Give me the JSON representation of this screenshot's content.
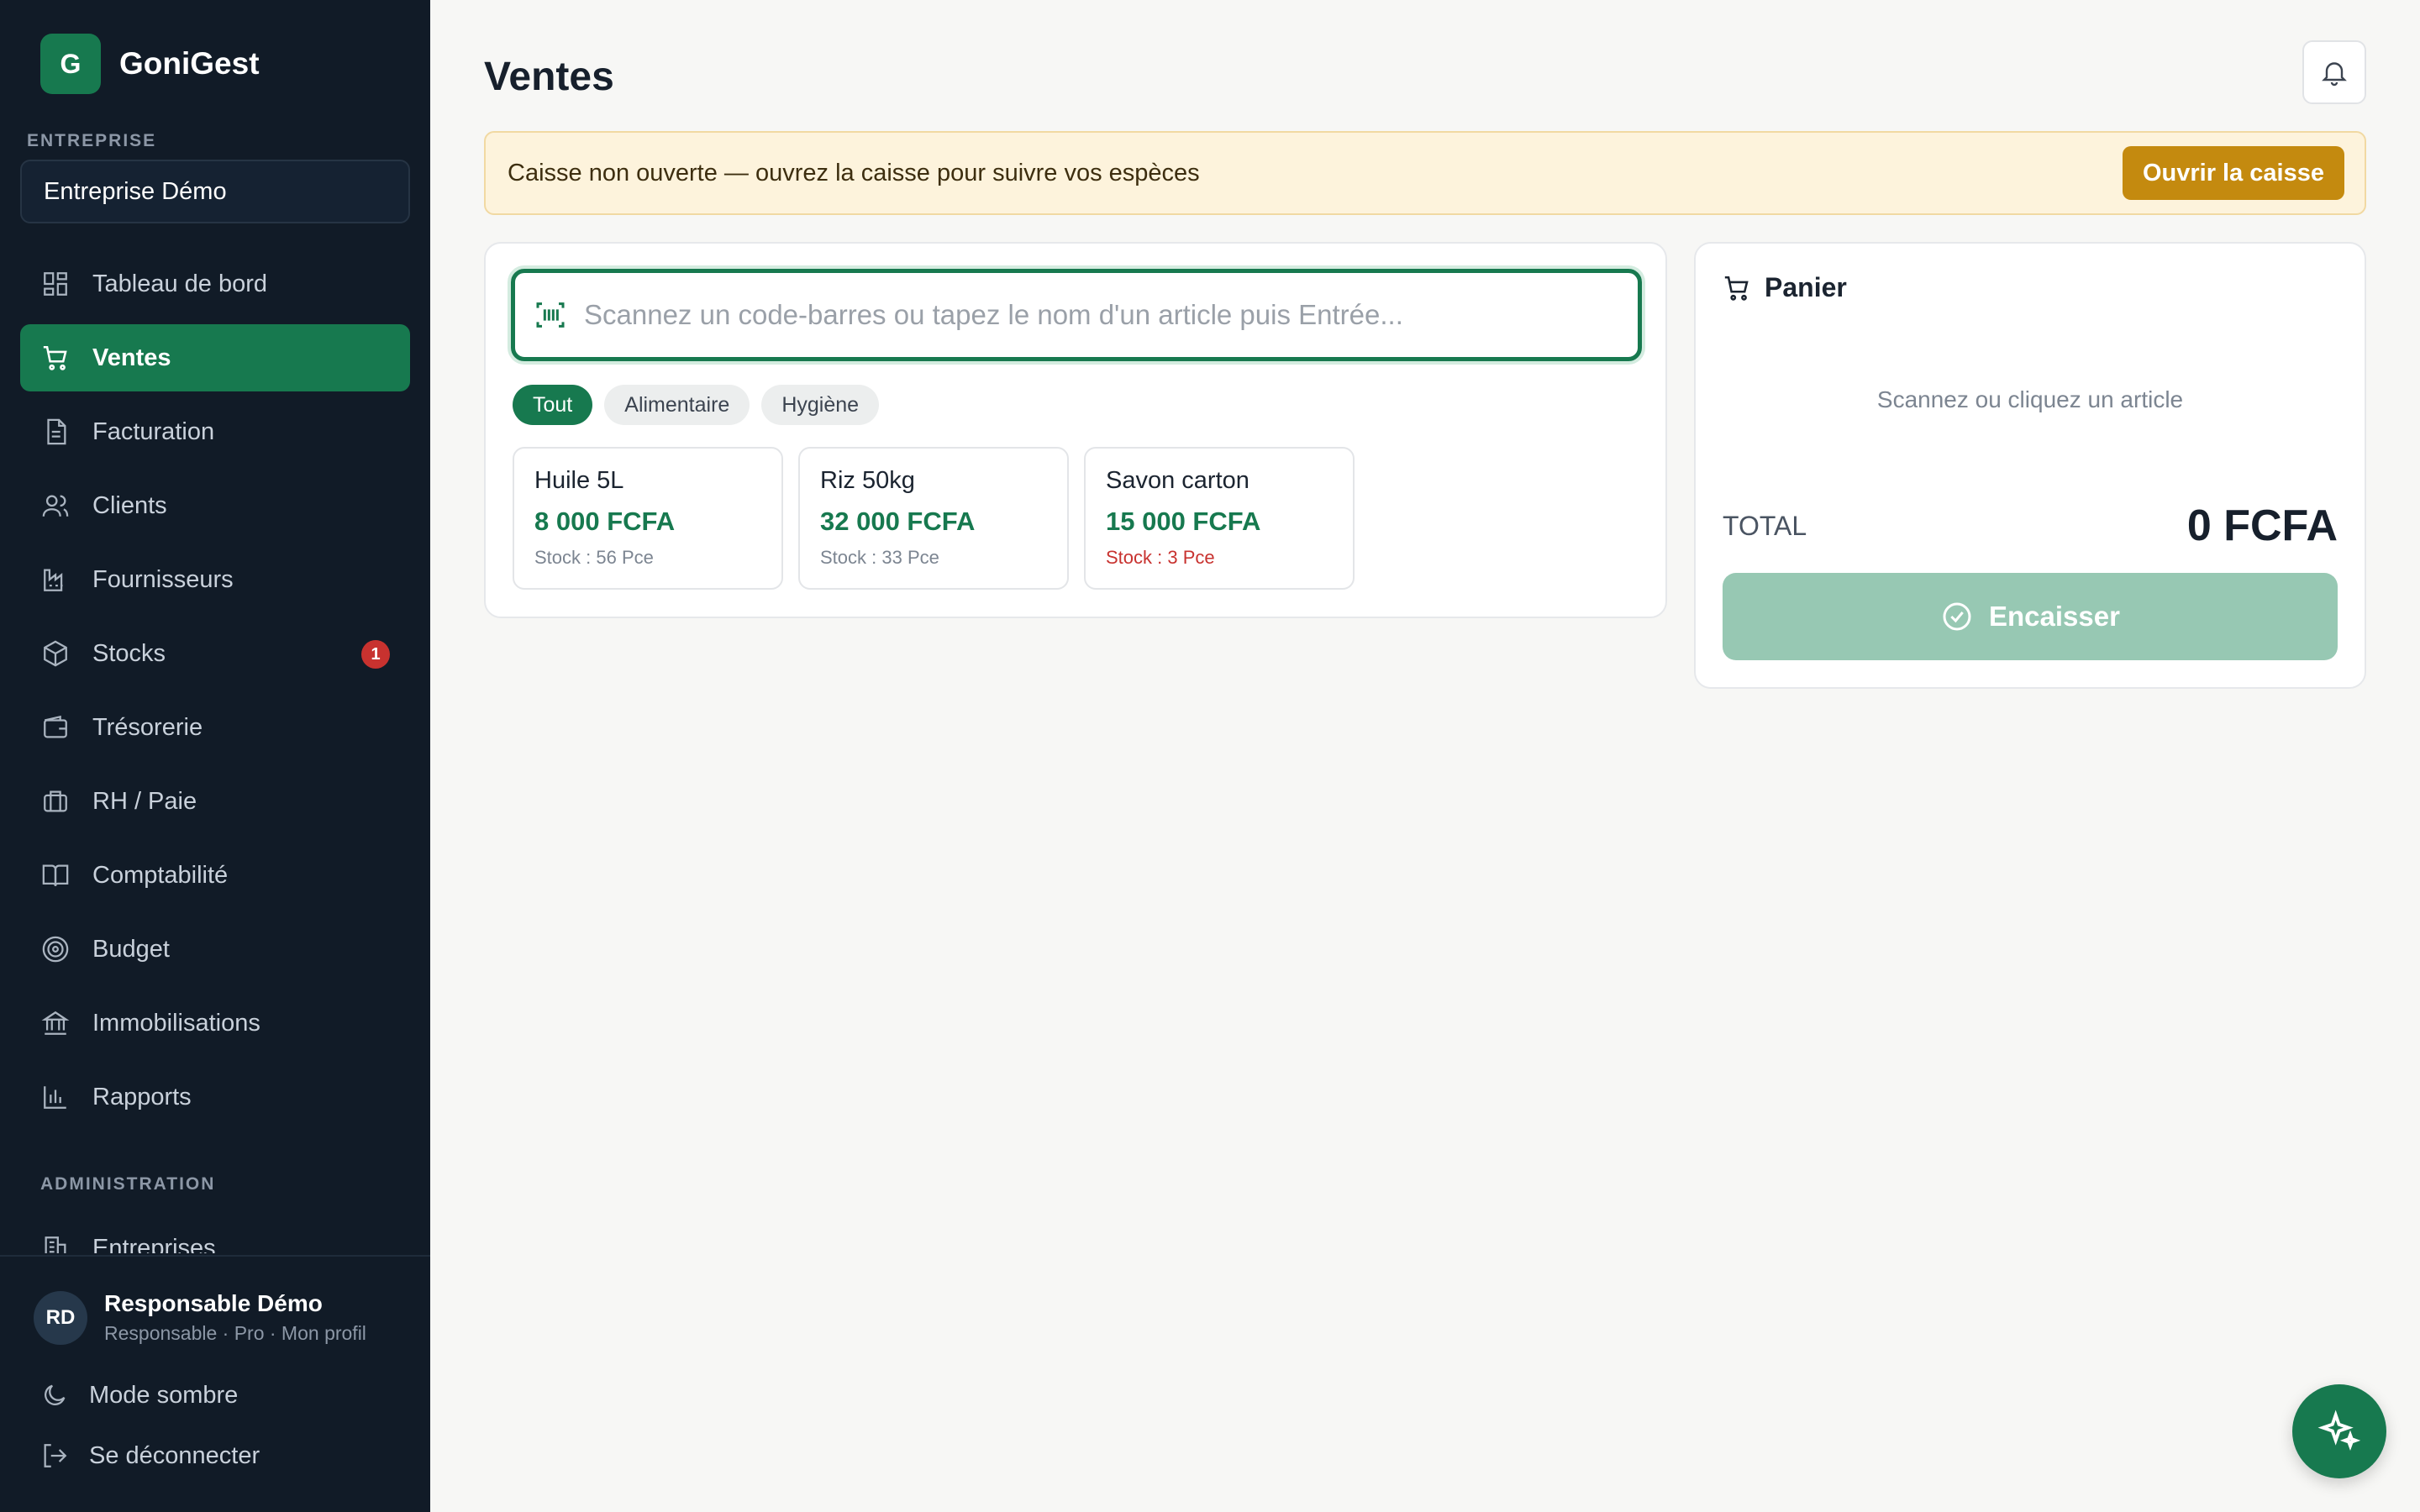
{
  "app": {
    "logo_letter": "G",
    "name": "GoniGest"
  },
  "sidebar": {
    "company_label": "ENTREPRISE",
    "company_name": "Entreprise Démo",
    "items": [
      {
        "label": "Tableau de bord",
        "icon": "dashboard-icon"
      },
      {
        "label": "Ventes",
        "icon": "cart-icon",
        "active": true
      },
      {
        "label": "Facturation",
        "icon": "document-icon"
      },
      {
        "label": "Clients",
        "icon": "users-icon"
      },
      {
        "label": "Fournisseurs",
        "icon": "factory-icon"
      },
      {
        "label": "Stocks",
        "icon": "box-icon",
        "badge": "1"
      },
      {
        "label": "Trésorerie",
        "icon": "wallet-icon"
      },
      {
        "label": "RH / Paie",
        "icon": "briefcase-icon"
      },
      {
        "label": "Comptabilité",
        "icon": "book-icon"
      },
      {
        "label": "Budget",
        "icon": "target-icon"
      },
      {
        "label": "Immobilisations",
        "icon": "bank-icon"
      },
      {
        "label": "Rapports",
        "icon": "bar-chart-icon"
      }
    ],
    "admin_label": "ADMINISTRATION",
    "admin_items": [
      {
        "label": "Entreprises",
        "icon": "building-icon"
      }
    ],
    "user": {
      "initials": "RD",
      "name": "Responsable Démo",
      "subtitle": "Responsable · Pro · Mon profil"
    },
    "dark_mode_label": "Mode sombre",
    "logout_label": "Se déconnecter"
  },
  "main": {
    "title": "Ventes",
    "alert": {
      "text": "Caisse non ouverte — ouvrez la caisse pour suivre vos espèces",
      "button": "Ouvrir la caisse"
    },
    "search": {
      "placeholder": "Scannez un code-barres ou tapez le nom d'un article puis Entrée..."
    },
    "categories": [
      "Tout",
      "Alimentaire",
      "Hygiène"
    ],
    "products": [
      {
        "name": "Huile 5L",
        "price": "8 000 FCFA",
        "stock": "Stock : 56 Pce",
        "low": false
      },
      {
        "name": "Riz 50kg",
        "price": "32 000 FCFA",
        "stock": "Stock : 33 Pce",
        "low": false
      },
      {
        "name": "Savon carton",
        "price": "15 000 FCFA",
        "stock": "Stock : 3 Pce",
        "low": true
      }
    ],
    "cart": {
      "title": "Panier",
      "empty_text": "Scannez ou cliquez un article",
      "total_label": "TOTAL",
      "total_value": "0 FCFA",
      "checkout_label": "Encaisser"
    }
  },
  "colors": {
    "brand": "#17794f",
    "sidebar_bg": "#111b27",
    "alert_bg": "#fdf3dc",
    "alert_button": "#c48a0f",
    "badge": "#c8322f"
  }
}
